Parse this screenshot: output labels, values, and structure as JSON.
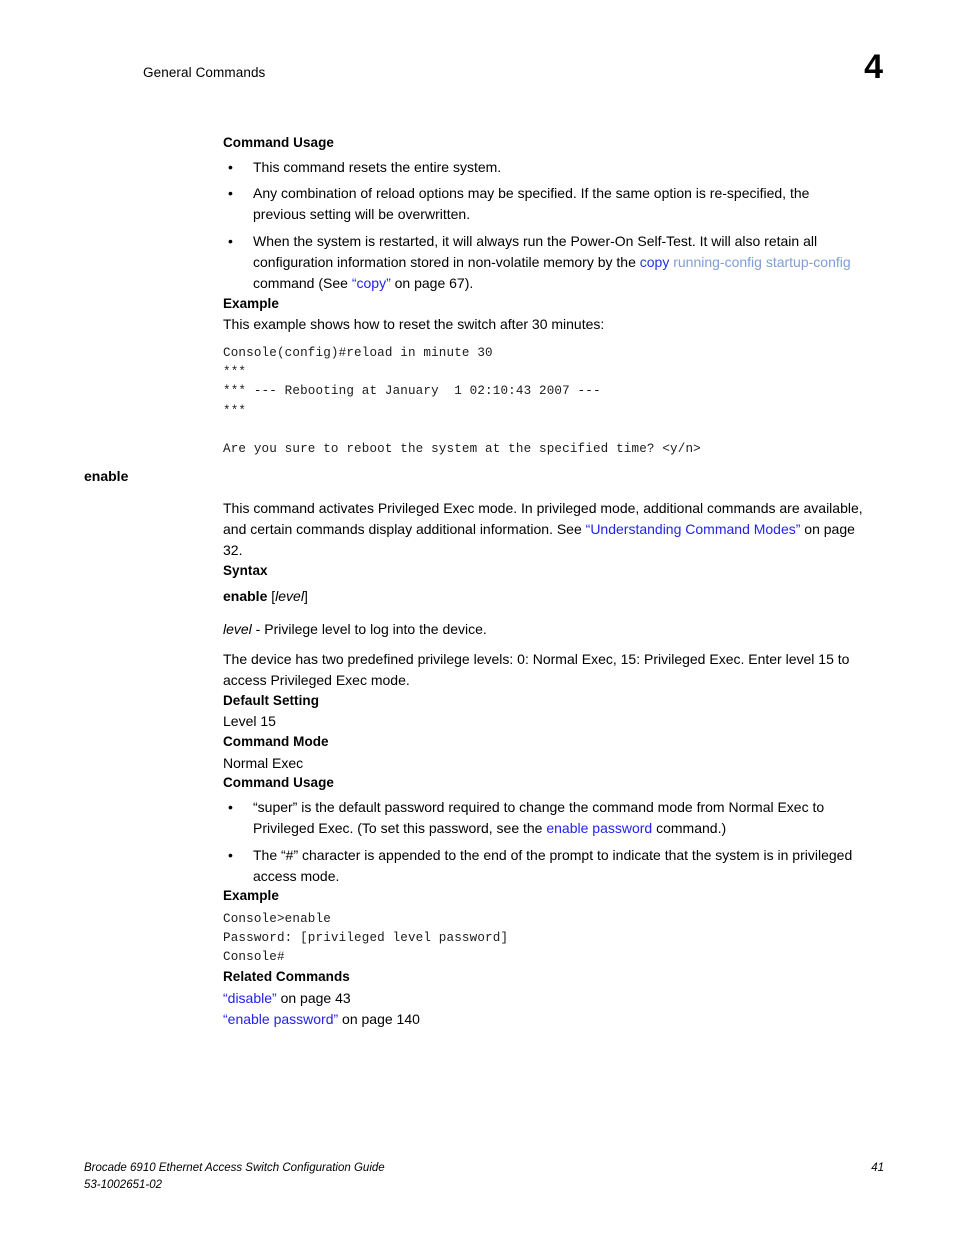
{
  "header": {
    "running_head": "General Commands",
    "chapter_number": "4"
  },
  "colors": {
    "link": "#2222ee",
    "link_soft": "#7d9ed6",
    "link_strong": "#2233dd",
    "text": "#000000",
    "background": "#ffffff"
  },
  "reload_section": {
    "command_usage_heading": "Command Usage",
    "bullets": [
      {
        "text": "This command resets the entire system."
      },
      {
        "text": "Any combination of reload options may be specified. If the same option is re-specified, the previous setting will be overwritten."
      },
      {
        "prefix": "When the system is restarted, it will always run the Power-On Self-Test. It will also retain all configuration information stored in non-volatile memory by the ",
        "link_strong": "copy",
        "link_soft": " running-config startup-config",
        "middle": " command (See ",
        "link_quoted": "“copy”",
        "suffix": " on page 67)."
      }
    ],
    "example_heading": "Example",
    "example_intro": "This example shows how to reset the switch after 30 minutes:",
    "example_code": "Console(config)#reload in minute 30\n***\n*** --- Rebooting at January  1 02:10:43 2007 ---\n***\n\nAre you sure to reboot the system at the specified time? <y/n>"
  },
  "enable_section": {
    "marginal_title": "enable",
    "intro_prefix": "This command activates Privileged Exec mode. In privileged mode, additional commands are available, and certain commands display additional information. See ",
    "intro_link": "“Understanding Command Modes”",
    "intro_suffix": " on page 32.",
    "syntax_heading": "Syntax",
    "syntax_command": "enable",
    "syntax_option_open": " [",
    "syntax_option_italic": "level",
    "syntax_option_close": "]",
    "param_italic": "level",
    "param_desc": " - Privilege level to log into the device.",
    "param_note": "The device has two predefined privilege levels: 0: Normal Exec, 15: Privileged Exec. Enter level 15 to access Privileged Exec mode.",
    "default_setting_heading": "Default Setting",
    "default_setting_value": "Level 15",
    "command_mode_heading": "Command Mode",
    "command_mode_value": "Normal Exec",
    "command_usage_heading": "Command Usage",
    "usage_bullets": [
      {
        "prefix": "“super” is the default password required to change the command mode from Normal Exec to Privileged Exec. (To set this password, see the ",
        "link": "enable password",
        "suffix": " command.)"
      },
      {
        "text": "The “#” character is appended to the end of the prompt to indicate that the system is in privileged access mode."
      }
    ],
    "example_heading": "Example",
    "example_code": "Console>enable\nPassword: [privileged level password]\nConsole#",
    "related_heading": "Related Commands",
    "related_links": [
      {
        "link": "“disable”",
        "suffix": " on page 43"
      },
      {
        "link": "“enable password”",
        "suffix": " on page 140"
      }
    ]
  },
  "footer": {
    "guide_title": "Brocade 6910 Ethernet Access Switch Configuration Guide",
    "doc_number": "53-1002651-02",
    "page_number": "41"
  }
}
